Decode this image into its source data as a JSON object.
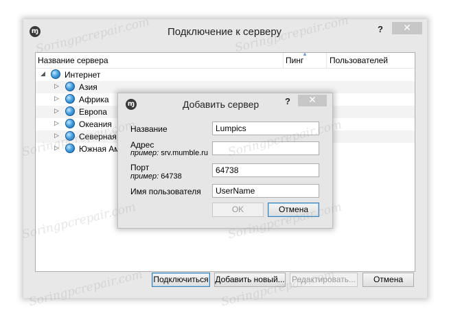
{
  "window": {
    "icon_glyph": "\u0001F50A",
    "title": "Подключение к серверу",
    "help": "?",
    "close": "✕"
  },
  "tree": {
    "columns": [
      "Название сервера",
      "Пинг",
      "Пользователей"
    ],
    "root": "Интернет",
    "children": [
      "Азия",
      "Африка",
      "Европа",
      "Океания",
      "Северная",
      "Южная Ам"
    ]
  },
  "footer": {
    "connect": "Подключиться",
    "add_new": "Добавить новый...",
    "edit": "Редактировать...",
    "cancel": "Отмена"
  },
  "dialog": {
    "title": "Добавить сервер",
    "help": "?",
    "close": "✕",
    "name_label": "Название",
    "name_value": "Lumpics",
    "address_label": "Адрес",
    "address_hint_prefix": "пример:",
    "address_hint_value": "srv.mumble.ru",
    "address_value": "",
    "port_label": "Порт",
    "port_hint_prefix": "пример:",
    "port_hint_value": "64738",
    "port_value": "64738",
    "username_label": "Имя пользователя",
    "username_value": "UserName",
    "ok": "OK",
    "cancel": "Отмена"
  },
  "watermark": "Soringpcrepair.com",
  "colors": {
    "close_btn": "#c7c7c7",
    "focus_border": "#3c7fb1",
    "globe": "#4aa3e0"
  }
}
